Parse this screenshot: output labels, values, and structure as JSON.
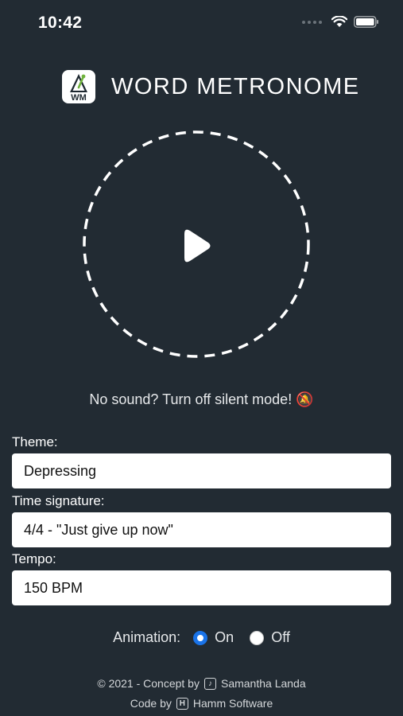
{
  "status_bar": {
    "time": "10:42"
  },
  "header": {
    "logo_text": "WM",
    "title": "WORD METRONOME"
  },
  "player": {
    "play_icon": "play-icon"
  },
  "hint": {
    "text": "No sound? Turn off silent mode! 🔕"
  },
  "form": {
    "theme_label": "Theme:",
    "theme_value": "Depressing",
    "time_signature_label": "Time signature:",
    "time_signature_value": "4/4 - \"Just give up now\"",
    "tempo_label": "Tempo:",
    "tempo_value": "150 BPM"
  },
  "animation": {
    "label": "Animation:",
    "on_label": "On",
    "off_label": "Off",
    "selected": "On"
  },
  "footer": {
    "line1_prefix": "© 2021 - Concept by",
    "line1_name": "Samantha Landa",
    "line2_prefix": "Code by",
    "line2_name": "Hamm Software",
    "tiktok_icon": "tiktok-icon",
    "hamm_icon": "hamm-software-icon"
  },
  "colors": {
    "background": "#222b33",
    "accent": "#1a73e8",
    "field_background": "#ffffff"
  }
}
